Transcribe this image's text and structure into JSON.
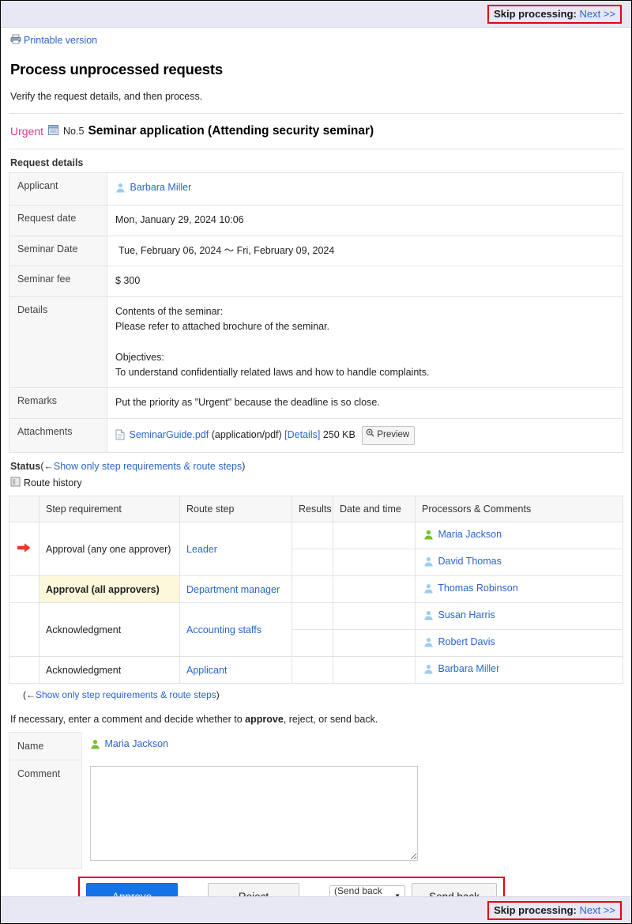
{
  "topbar": {
    "skip_label": "Skip processing:",
    "skip_link": "Next >>"
  },
  "bottombar": {
    "skip_label": "Skip processing:",
    "skip_link": "Next >>"
  },
  "printable": {
    "label": "Printable version",
    "icon": "printer-icon"
  },
  "page": {
    "title": "Process unprocessed requests",
    "lead": "Verify the request details, and then process."
  },
  "request_header": {
    "priority": "Urgent",
    "number": "No.5",
    "name": "Seminar application (Attending security seminar)",
    "icon": "request-form-icon"
  },
  "request_details": {
    "heading": "Request details",
    "rows": [
      {
        "label": "Applicant",
        "type": "user",
        "value": "Barbara Miller"
      },
      {
        "label": "Request date",
        "type": "text",
        "value": "Mon, January 29, 2024 10:06"
      },
      {
        "label": "Seminar Date",
        "type": "daterange",
        "start": "Tue, February 06, 2024",
        "sep": "〜",
        "end": "Fri, February 09, 2024"
      },
      {
        "label": "Seminar fee",
        "type": "text",
        "value": "$ 300"
      },
      {
        "label": "Details",
        "type": "multiline",
        "lines": [
          "Contents of the seminar:",
          "Please refer to attached brochure of the seminar.",
          "",
          "Objectives:",
          "To understand confidentially related laws and how to handle complaints."
        ]
      },
      {
        "label": "Remarks",
        "type": "text",
        "value": "Put the priority as \"Urgent\" because the deadline is so close."
      },
      {
        "label": "Attachments",
        "type": "attachment"
      }
    ],
    "attachment": {
      "filename": "SeminarGuide.pdf",
      "mime": "(application/pdf)",
      "details_link": "[Details]",
      "size": "250 KB",
      "preview_label": "Preview"
    }
  },
  "status": {
    "heading": "Status",
    "toggle_prefix": "(←",
    "toggle_link": "Show only step requirements & route steps",
    "toggle_suffix": ")",
    "route_history_label": "Route history",
    "bottom_toggle_prefix": "(←",
    "bottom_toggle_link": "Show only step requirements & route steps",
    "bottom_toggle_suffix": ")",
    "columns": [
      "",
      "Step requirement",
      "Route step",
      "Results",
      "Date and time",
      "Processors & Comments"
    ],
    "rows": [
      {
        "marker": "current",
        "step_requirement": "Approval (any one approver)",
        "highlight": false,
        "route_step": "Leader",
        "results": "",
        "datetime": "",
        "processors": [
          {
            "name": "Maria Jackson",
            "state": "active"
          },
          {
            "name": "David Thomas",
            "state": "idle"
          }
        ]
      },
      {
        "marker": "",
        "step_requirement": "Approval (all approvers)",
        "highlight": true,
        "route_step": "Department manager",
        "results": "",
        "datetime": "",
        "processors": [
          {
            "name": "Thomas Robinson",
            "state": "idle"
          }
        ]
      },
      {
        "marker": "",
        "step_requirement": "Acknowledgment",
        "highlight": false,
        "route_step": "Accounting staffs",
        "results": "",
        "datetime": "",
        "processors": [
          {
            "name": "Susan Harris",
            "state": "idle"
          },
          {
            "name": "Robert Davis",
            "state": "idle"
          }
        ]
      },
      {
        "marker": "",
        "step_requirement": "Acknowledgment",
        "highlight": false,
        "route_step": "Applicant",
        "results": "",
        "datetime": "",
        "processors": [
          {
            "name": "Barbara Miller",
            "state": "idle"
          }
        ]
      }
    ]
  },
  "decision": {
    "instruction_pre": "If necessary, enter a comment and decide whether to ",
    "instruction_bold": "approve",
    "instruction_post": ", reject, or send back.",
    "name_label": "Name",
    "name_value": "Maria Jackson",
    "comment_label": "Comment",
    "comment_value": "",
    "comment_placeholder": ""
  },
  "actions": {
    "approve": "Approve",
    "reject": "Reject",
    "sendback_to": "(Send back to)",
    "sendback": "Send back"
  },
  "colors": {
    "accent_blue": "#1473e6",
    "link_blue": "#2b66c9",
    "urgent_pink": "#e0338c",
    "highlight_red": "#e60012",
    "row_highlight": "#fdf8dc",
    "bar_bg": "#e7e8f3",
    "active_user_green": "#6fbf2f"
  }
}
